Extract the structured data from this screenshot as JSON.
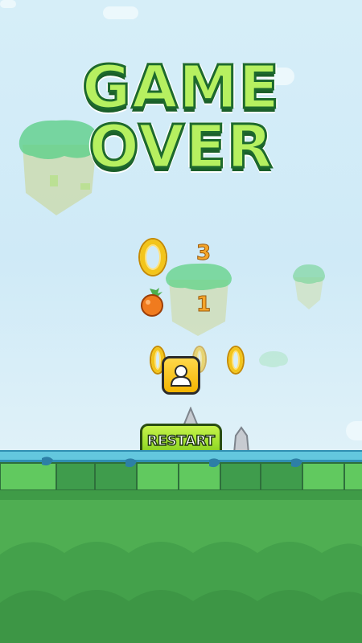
{
  "game": {
    "title_line1": "GAME",
    "title_line2": "OVER",
    "rings_count": "3",
    "fruits_count": "1",
    "restart_label": "RESTART"
  },
  "colors": {
    "sky": "#d6eef8",
    "title_fill": "#b6f060",
    "title_outline": "#1d6a2d",
    "ring_gold": "#f3c51b",
    "button_green": "#9ee02e",
    "button_yellow": "#ffd84a",
    "ground_dark": "#3d9b4a",
    "ground_light": "#58c45b"
  },
  "icons": {
    "ring": "gold-ring-icon",
    "fruit": "orange-icon",
    "profile": "user-icon",
    "spike": "spike-icon"
  }
}
